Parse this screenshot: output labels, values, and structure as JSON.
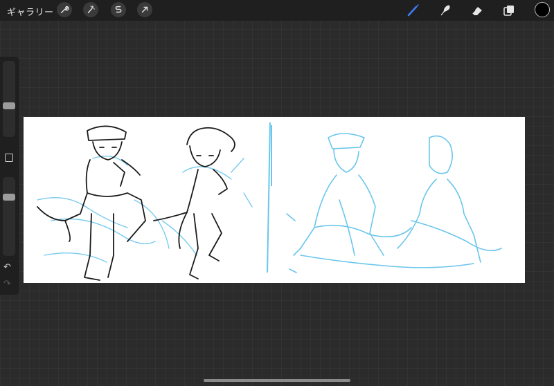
{
  "topbar": {
    "gallery_label": "ギャラリー",
    "left_tools": [
      "wrench-icon",
      "magic-wand-icon",
      "selection-s-icon",
      "transform-arrow-icon"
    ],
    "right_tools": [
      "brush-icon",
      "smudge-icon",
      "eraser-icon",
      "layers-icon"
    ],
    "active_tool": "brush-icon",
    "current_color": "#000000",
    "accent": "#3d7cf5"
  },
  "sidebar": {
    "brush_size_level": 0.6,
    "opacity_level": 0.25,
    "undo_icon": "undo-icon",
    "redo_icon": "redo-icon"
  },
  "canvas": {
    "background": "#ffffff",
    "ink_color": "#1a1a1a",
    "sketch_color": "#6ac6ec"
  }
}
